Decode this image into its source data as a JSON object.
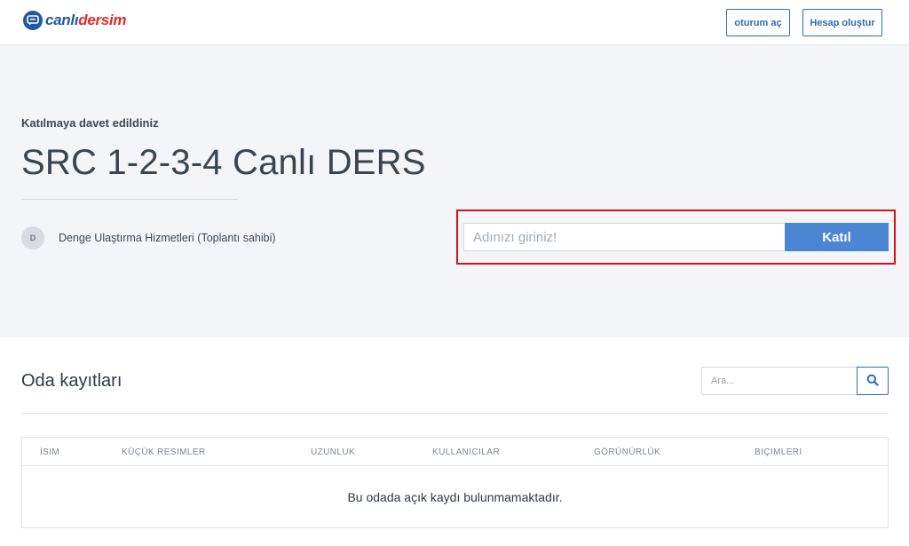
{
  "header": {
    "logo": {
      "part1": "canlı",
      "part2": "dersim",
      "icon": "chat-bubble-icon",
      "brand_colors": {
        "blue": "#1f5c9e",
        "red": "#e02b2b"
      }
    },
    "login_label": "oturum aç",
    "register_label": "Hesap oluştur"
  },
  "hero": {
    "invited_text": "Katılmaya davet edildiniz",
    "room_title": "SRC 1-2-3-4 Canlı DERS",
    "owner": {
      "avatar_initial": "D",
      "name": "Denge Ulaştırma Hizmetleri (Toplantı sahibi)"
    },
    "join": {
      "name_placeholder": "Adınızı giriniz!",
      "name_value": "",
      "button_label": "Katıl",
      "highlight_color": "#d9101a",
      "button_color": "#4a86d1"
    }
  },
  "recordings": {
    "title": "Oda kayıtları",
    "search_placeholder": "Ara...",
    "search_icon": "search-icon",
    "columns": [
      "İSIM",
      "KÜÇÜK RESIMLER",
      "UZUNLUK",
      "KULLANICILAR",
      "GÖRÜNÜRLÜK",
      "BIÇIMLERI"
    ],
    "empty_message": "Bu odada açık kaydı bulunmamaktadır."
  }
}
